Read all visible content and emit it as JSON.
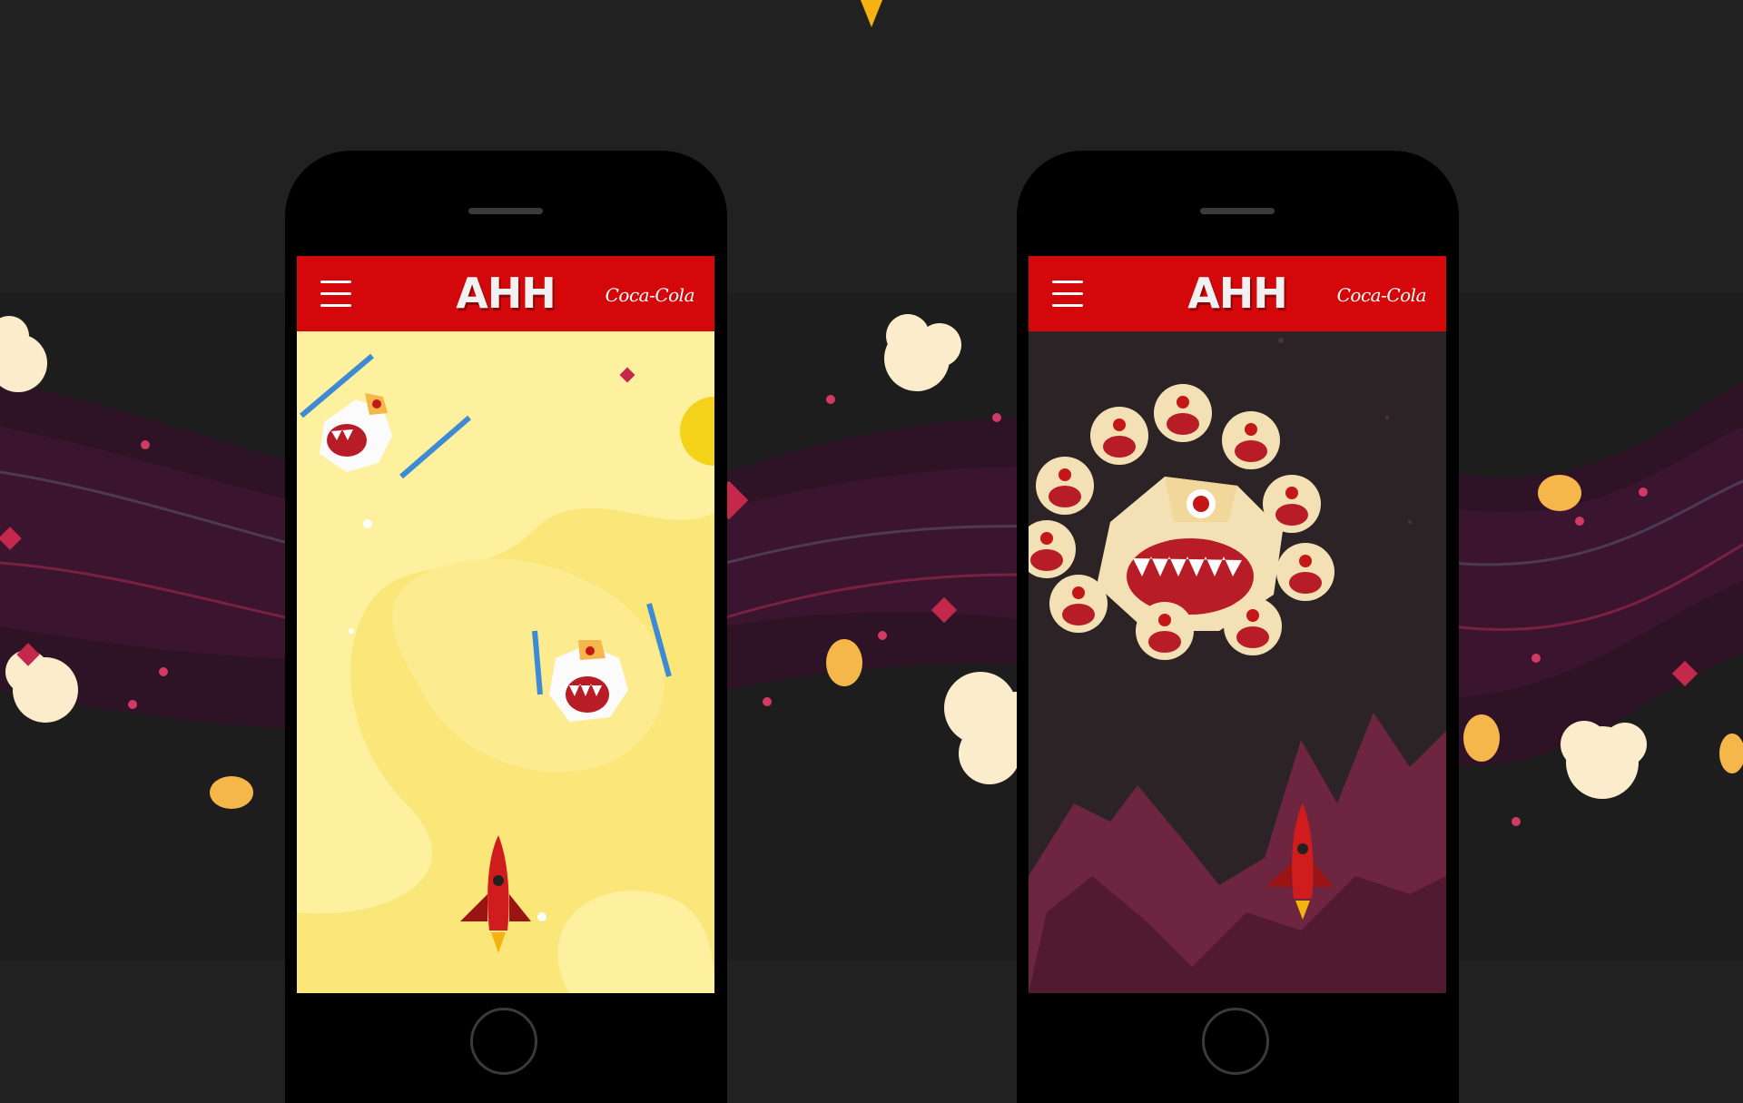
{
  "colors": {
    "page_background": "#212121",
    "app_header": "#d4070a",
    "desert_sand": "#fbe67a",
    "night_sky": "#2b2325",
    "purple_wave": "#3b1530",
    "popcorn": "#fbeccc",
    "crystal": "#c4294b"
  },
  "phones": [
    {
      "app_logo": "AHH",
      "brand_name": "Coca-Cola",
      "menu_icon": "hamburger-icon",
      "scene": "desert-level"
    },
    {
      "app_logo": "AHH",
      "brand_name": "Coca-Cola",
      "menu_icon": "hamburger-icon",
      "scene": "boss-level"
    }
  ]
}
